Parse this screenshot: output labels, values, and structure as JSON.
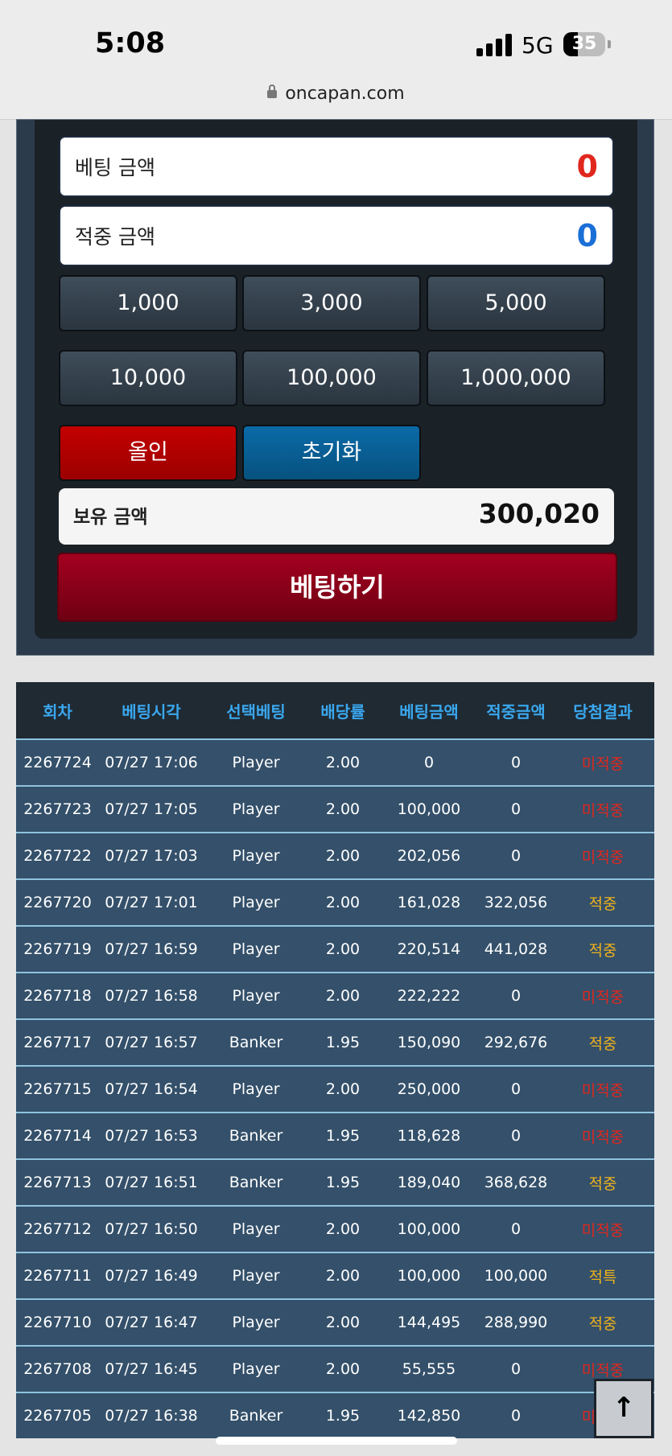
{
  "status_bar": {
    "time": "5:08",
    "network": "5G",
    "battery": "35",
    "url": "oncapan.com"
  },
  "bet_panel": {
    "bet_amount_label": "베팅 금액",
    "bet_amount_value": "0",
    "win_amount_label": "적중 금액",
    "win_amount_value": "0",
    "chips": [
      "1,000",
      "3,000",
      "5,000",
      "10,000",
      "100,000",
      "1,000,000"
    ],
    "allin_label": "올인",
    "reset_label": "초기화",
    "holding_label": "보유 금액",
    "holding_value": "300,020",
    "bet_button_label": "베팅하기"
  },
  "colors": {
    "bet_amount": "#e0271e",
    "win_amount": "#1a6fd6",
    "miss": "#e0271e",
    "hit": "#f0b21c"
  },
  "history": {
    "headers": [
      "회차",
      "베팅시각",
      "선택베팅",
      "배당률",
      "베팅금액",
      "적중금액",
      "당첨결과"
    ],
    "rows": [
      [
        "2267724",
        "07/27 17:06",
        "Player",
        "2.00",
        "0",
        "0",
        "미적중"
      ],
      [
        "2267723",
        "07/27 17:05",
        "Player",
        "2.00",
        "100,000",
        "0",
        "미적중"
      ],
      [
        "2267722",
        "07/27 17:03",
        "Player",
        "2.00",
        "202,056",
        "0",
        "미적중"
      ],
      [
        "2267720",
        "07/27 17:01",
        "Player",
        "2.00",
        "161,028",
        "322,056",
        "적중"
      ],
      [
        "2267719",
        "07/27 16:59",
        "Player",
        "2.00",
        "220,514",
        "441,028",
        "적중"
      ],
      [
        "2267718",
        "07/27 16:58",
        "Player",
        "2.00",
        "222,222",
        "0",
        "미적중"
      ],
      [
        "2267717",
        "07/27 16:57",
        "Banker",
        "1.95",
        "150,090",
        "292,676",
        "적중"
      ],
      [
        "2267715",
        "07/27 16:54",
        "Player",
        "2.00",
        "250,000",
        "0",
        "미적중"
      ],
      [
        "2267714",
        "07/27 16:53",
        "Banker",
        "1.95",
        "118,628",
        "0",
        "미적중"
      ],
      [
        "2267713",
        "07/27 16:51",
        "Banker",
        "1.95",
        "189,040",
        "368,628",
        "적중"
      ],
      [
        "2267712",
        "07/27 16:50",
        "Player",
        "2.00",
        "100,000",
        "0",
        "미적중"
      ],
      [
        "2267711",
        "07/27 16:49",
        "Player",
        "2.00",
        "100,000",
        "100,000",
        "적특"
      ],
      [
        "2267710",
        "07/27 16:47",
        "Player",
        "2.00",
        "144,495",
        "288,990",
        "적중"
      ],
      [
        "2267708",
        "07/27 16:45",
        "Player",
        "2.00",
        "55,555",
        "0",
        "미적중"
      ],
      [
        "2267705",
        "07/27 16:38",
        "Banker",
        "1.95",
        "142,850",
        "0",
        "미적중"
      ]
    ]
  },
  "scroll_top_icon": "arrow-up-icon"
}
